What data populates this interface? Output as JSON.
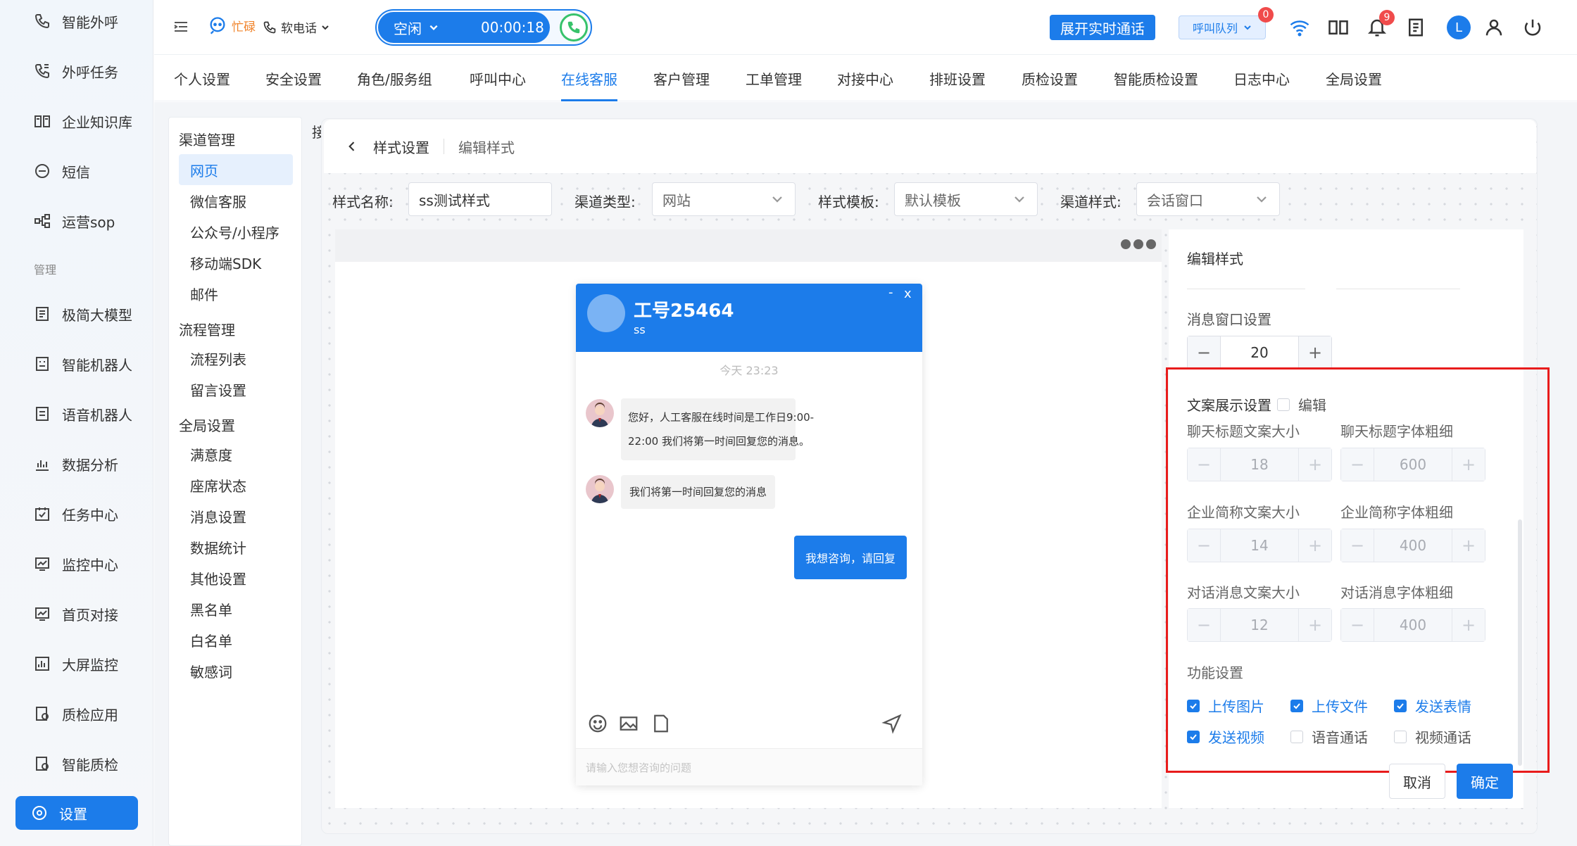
{
  "sidebar": {
    "items": [
      {
        "label": "智能外呼",
        "icon": "phone-outgoing-icon"
      },
      {
        "label": "外呼任务",
        "icon": "phone-task-icon"
      },
      {
        "label": "企业知识库",
        "icon": "book-icon"
      },
      {
        "label": "短信",
        "icon": "sms-icon"
      },
      {
        "label": "运营sop",
        "icon": "flow-icon"
      },
      {
        "label": "极简大模型",
        "icon": "model-icon"
      },
      {
        "label": "智能机器人",
        "icon": "robot-icon"
      },
      {
        "label": "语音机器人",
        "icon": "voice-robot-icon"
      },
      {
        "label": "数据分析",
        "icon": "bar-chart-icon"
      },
      {
        "label": "任务中心",
        "icon": "calendar-check-icon"
      },
      {
        "label": "监控中心",
        "icon": "monitor-chart-icon"
      },
      {
        "label": "首页对接",
        "icon": "home-link-icon"
      },
      {
        "label": "大屏监控",
        "icon": "screen-chart-icon"
      },
      {
        "label": "质检应用",
        "icon": "qc-app-icon"
      },
      {
        "label": "智能质检",
        "icon": "qc-smart-icon"
      }
    ],
    "section_label": "管理",
    "active_label": "设置"
  },
  "topbar": {
    "status_busy": "忙碌",
    "softphone": "软电话",
    "call_status": "空闲",
    "call_timer": "00:00:18",
    "realtime_btn": "展开实时通话",
    "queue_btn": "呼叫队列",
    "queue_badge": "0",
    "notify_badge": "9",
    "user_initial": "L"
  },
  "main_tabs": [
    "个人设置",
    "安全设置",
    "角色/服务组",
    "呼叫中心",
    "在线客服",
    "客户管理",
    "工单管理",
    "对接中心",
    "排班设置",
    "质检设置",
    "智能质检设置",
    "日志中心",
    "全局设置"
  ],
  "subnav": {
    "group1": "渠道管理",
    "group1_items": [
      "网页",
      "微信客服",
      "公众号/小程序",
      "移动端SDK",
      "邮件"
    ],
    "group2": "流程管理",
    "group2_items": [
      "流程列表",
      "留言设置"
    ],
    "group3": "全局设置",
    "group3_items": [
      "满意度",
      "座席状态",
      "消息设置",
      "数据统计",
      "其他设置",
      "黑名单",
      "白名单",
      "敏感词"
    ],
    "clipped_char": "接"
  },
  "breadcrumb": {
    "back": "样式设置",
    "current": "编辑样式"
  },
  "form": {
    "name_label": "样式名称:",
    "name_value": "ss测试样式",
    "channel_type_label": "渠道类型:",
    "channel_type_value": "网站",
    "template_label": "样式模板:",
    "template_value": "默认模板",
    "channel_style_label": "渠道样式:",
    "channel_style_value": "会话窗口"
  },
  "chat": {
    "title": "工号25464",
    "subtitle": "ss",
    "minimize": "-",
    "close": "x",
    "time": "今天 23:23",
    "msg1_line1": "您好，人工客服在线时间是工作日9:00-",
    "msg1_line2": "22:00 我们将第一时间回复您的消息。",
    "msg2": "我们将第一时间回复您的消息",
    "msg_user": "我想咨询，请回复",
    "input_placeholder": "请输入您想咨询的问题"
  },
  "edit": {
    "title": "编辑样式",
    "msg_window_label": "消息窗口设置",
    "msg_window_value": "20",
    "text_display_label": "文案展示设置",
    "edit_label": "编辑",
    "fields": [
      {
        "label": "聊天标题文案大小",
        "value": "18"
      },
      {
        "label": "聊天标题字体粗细",
        "value": "600"
      },
      {
        "label": "企业简称文案大小",
        "value": "14"
      },
      {
        "label": "企业简称字体粗细",
        "value": "400"
      },
      {
        "label": "对话消息文案大小",
        "value": "12"
      },
      {
        "label": "对话消息字体粗细",
        "value": "400"
      }
    ],
    "features_label": "功能设置",
    "features": [
      {
        "label": "上传图片",
        "checked": true
      },
      {
        "label": "上传文件",
        "checked": true
      },
      {
        "label": "发送表情",
        "checked": true
      },
      {
        "label": "发送视频",
        "checked": true
      },
      {
        "label": "语音通话",
        "checked": false
      },
      {
        "label": "视频通话",
        "checked": false
      }
    ],
    "cancel": "取消",
    "confirm": "确定"
  }
}
